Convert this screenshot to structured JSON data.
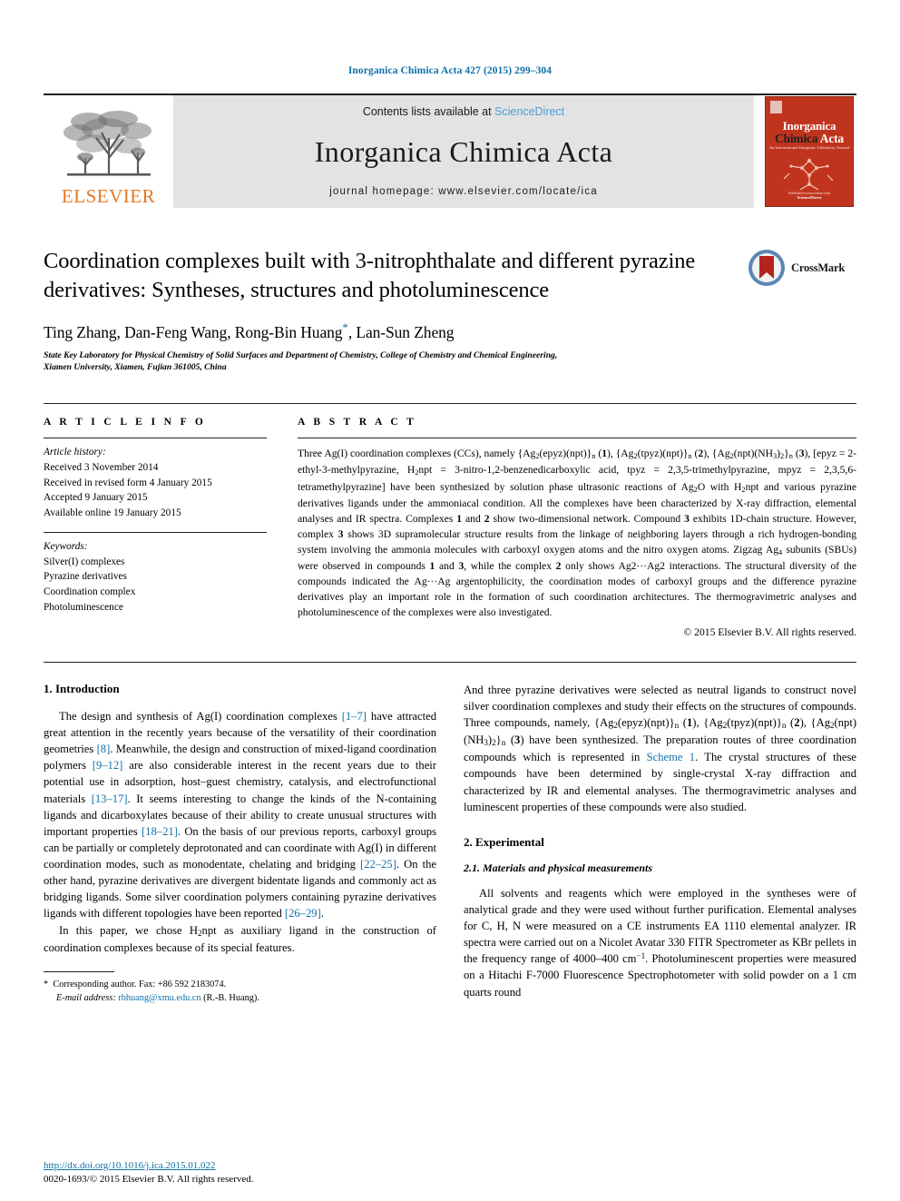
{
  "running_head": "Inorganica Chimica Acta 427 (2015) 299–304",
  "masthead": {
    "publisher_name": "ELSEVIER",
    "contents_prefix": "Contents lists available at ",
    "contents_link": "ScienceDirect",
    "journal_title": "Inorganica Chimica Acta",
    "homepage": "journal homepage: www.elsevier.com/locate/ica",
    "cover": {
      "line1": "Inorganica",
      "line2a": "Chimica",
      "line2b": "Acta",
      "subtitle": "An International Inorganic Chemistry Journal",
      "footer_small": "Published in association with",
      "footer_bold": "ScienceDirect"
    }
  },
  "article": {
    "title": "Coordination complexes built with 3-nitrophthalate and different pyrazine derivatives: Syntheses, structures and photoluminescence",
    "authors_pre": "Ting Zhang, Dan-Feng Wang, Rong-Bin Huang",
    "authors_post": ", Lan-Sun Zheng",
    "corresponding_marker": "*",
    "affiliation_line1": "State Key Laboratory for Physical Chemistry of Solid Surfaces and Department of Chemistry, College of Chemistry and Chemical Engineering,",
    "affiliation_line2": "Xiamen University, Xiamen, Fujian 361005, China",
    "crossmark_label": "CrossMark"
  },
  "article_info": {
    "heading": "A R T I C L E  I N F O",
    "history_label": "Article history:",
    "history": [
      "Received 3 November 2014",
      "Received in revised form 4 January 2015",
      "Accepted 9 January 2015",
      "Available online 19 January 2015"
    ],
    "keywords_label": "Keywords:",
    "keywords": [
      "Silver(I) complexes",
      "Pyrazine derivatives",
      "Coordination complex",
      "Photoluminescence"
    ]
  },
  "abstract": {
    "heading": "A B S T R A C T",
    "copyright": "© 2015 Elsevier B.V. All rights reserved."
  },
  "sections": {
    "introduction_heading": "1. Introduction",
    "experimental_heading": "2. Experimental",
    "materials_heading": "2.1. Materials and physical measurements"
  },
  "footnote": {
    "corresponding": "Corresponding author. Fax: +86 592 2183074.",
    "email_label": "E-mail address:",
    "email": "rbhuang@xmu.edu.cn",
    "email_owner": "(R.-B. Huang).",
    "doi": "http://dx.doi.org/10.1016/j.ica.2015.01.022",
    "issn": "0020-1693/© 2015 Elsevier B.V. All rights reserved."
  },
  "colors": {
    "link_blue": "#1070a8",
    "elsevier_orange": "#e87722",
    "band_gray": "#e3e3e3",
    "cover_red": "#c0341d"
  }
}
